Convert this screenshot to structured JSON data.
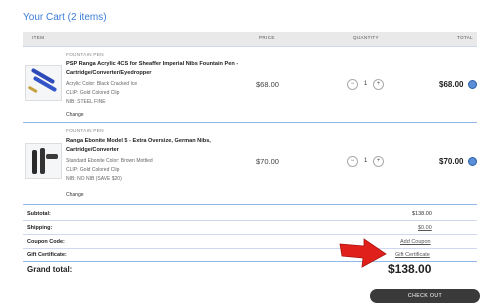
{
  "cart": {
    "title": "Your Cart (2 items)"
  },
  "table": {
    "headers": {
      "item": "ITEM",
      "price": "PRICE",
      "quantity": "QUANTITY",
      "total": "TOTAL"
    }
  },
  "items": [
    {
      "brand": "FOUNTAIN PEN",
      "name_line1": "PSP Ranga Acrylic 4CS for Sheaffer Imperial Nibs Fountain Pen -",
      "name_line2": "Cartridge/Converter/Eyedropper",
      "opt1": "Acrylic Color: Black Cracked Ice",
      "opt2": "CLIP: Gold Colored Clip",
      "opt3": "NIB: STEEL FINE",
      "change": "Change",
      "price": "$68.00",
      "minus": "−",
      "qty": "1",
      "plus": "+",
      "total": "$68.00"
    },
    {
      "brand": "FOUNTAIN PEN",
      "name_line1": "Ranga Ebonite Model 5 - Extra Oversize, German Nibs,",
      "name_line2": "Cartridge/Converter",
      "opt1": "Standard Ebonite Color: Brown Mottled",
      "opt2": "CLIP: Gold Colored Clip",
      "opt3": "NIB: NO NIB (SAVE $20)",
      "change": "Change",
      "price": "$70.00",
      "minus": "−",
      "qty": "1",
      "plus": "+",
      "total": "$70.00"
    }
  ],
  "summary": {
    "subtotal_label": "Subtotal:",
    "subtotal_value": "$138.00",
    "shipping_label": "Shipping:",
    "shipping_value": "$0.00",
    "coupon_label": "Coupon Code:",
    "coupon_link": "Add Coupon",
    "gift_label": "Gift Certificate:",
    "gift_link": "Gift Certificate",
    "grand_label": "Grand total:",
    "grand_value": "$138.00"
  },
  "checkout_label": "CHECK OUT",
  "colors": {
    "accent": "#3b7dd8",
    "button": "#3a3a3a",
    "arrow": "#e0201b"
  }
}
